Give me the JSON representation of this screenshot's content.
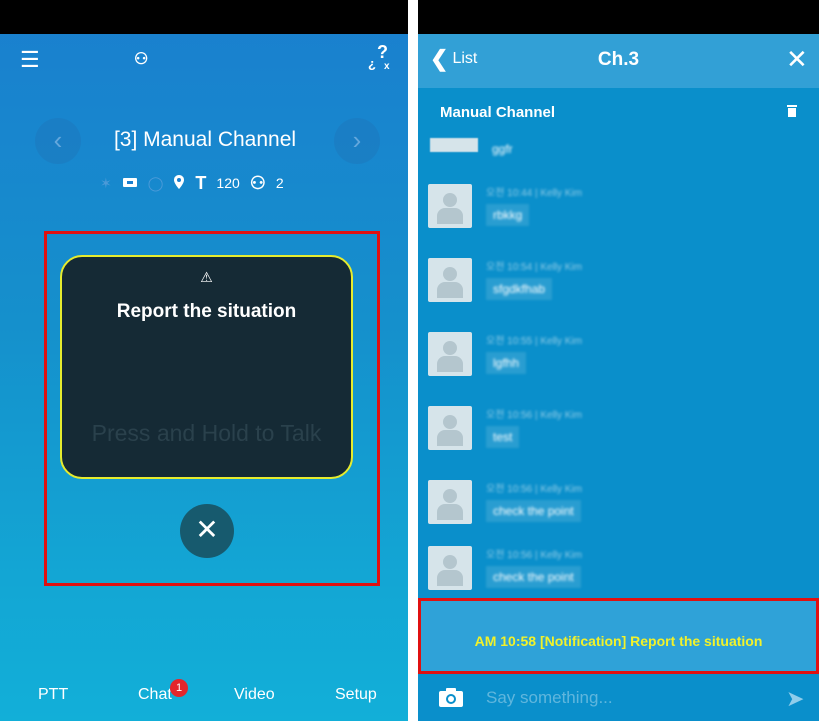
{
  "left": {
    "menu_icon": "hamburger-icon",
    "contacts_icon": "contacts-icon",
    "help_icon": "help-icon",
    "channel_title": "[3] Manual Channel",
    "status": {
      "t_label": "T",
      "t_value": "120",
      "members": "2"
    },
    "card": {
      "title": "Report the situation",
      "hint": "Press and Hold to Talk"
    },
    "tabs": [
      {
        "label": "PTT"
      },
      {
        "label": "Chat",
        "badge": "1"
      },
      {
        "label": "Video"
      },
      {
        "label": "Setup"
      }
    ]
  },
  "right": {
    "back_label": "List",
    "title": "Ch.3",
    "channel_name": "Manual Channel",
    "messages": [
      {
        "meta": "",
        "text": "ggfr"
      },
      {
        "meta": "오전 10:44 | Kelly Kim",
        "text": "rbkkg"
      },
      {
        "meta": "오전 10:54 | Kelly Kim",
        "text": "sfgdkfhab"
      },
      {
        "meta": "오전 10:55 | Kelly Kim",
        "text": "lgfhh"
      },
      {
        "meta": "오전 10:56 | Kelly Kim",
        "text": "test"
      },
      {
        "meta": "오전 10:56 | Kelly Kim",
        "text": "check the point"
      },
      {
        "meta": "오전 10:56 | Kelly Kim",
        "text": "check the point"
      }
    ],
    "notification": "AM 10:58 [Notification] Report the situation",
    "input_placeholder": "Say something..."
  },
  "colors": {
    "card_border": "#e6ec2e",
    "notification_text": "#f2f22a",
    "highlight": "#e01010",
    "badge": "#e3262c"
  }
}
